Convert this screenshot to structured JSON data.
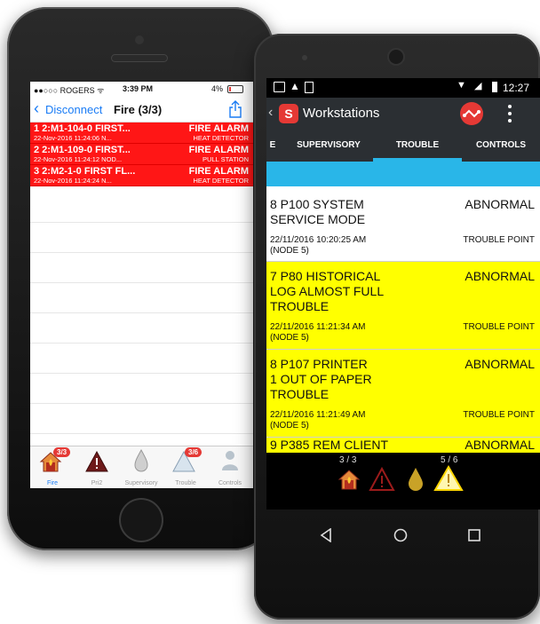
{
  "iphone": {
    "status": {
      "carrier": "●●○○○ ROGERS ᯤ",
      "time": "3:39 PM",
      "battery": "4%"
    },
    "nav": {
      "back_label": "Disconnect",
      "title": "Fire (3/3)"
    },
    "alarms": [
      {
        "title": "1 2:M1-104-0 FIRST...",
        "timestamp": "22-Nov-2016 11:24:06 N...",
        "type": "FIRE ALARM",
        "device": "HEAT DETECTOR"
      },
      {
        "title": "2 2:M1-109-0 FIRST...",
        "timestamp": "22-Nov-2016 11:24:12 NOD...",
        "type": "FIRE ALARM",
        "device": "PULL STATION"
      },
      {
        "title": "3 2:M2-1-0 FIRST FL...",
        "timestamp": "22-Nov-2016 11:24:24 N...",
        "type": "FIRE ALARM",
        "device": "HEAT DETECTOR"
      }
    ],
    "tabs": {
      "fire": {
        "label": "Fire",
        "badge": "3/3"
      },
      "pri2": {
        "label": "Pri2"
      },
      "supervisory": {
        "label": "Supervisory"
      },
      "trouble": {
        "label": "Trouble",
        "badge": "3/6"
      },
      "controls": {
        "label": "Controls"
      }
    },
    "colors": {
      "alarm_row": "#ff1616",
      "accent": "#1a7cf5"
    }
  },
  "android": {
    "status": {
      "time": "12:27"
    },
    "toolbar": {
      "title": "Workstations"
    },
    "tabs": {
      "left_fragment": "E",
      "supervisory": "SUPERVISORY",
      "trouble": "TROUBLE",
      "controls": "CONTROLS"
    },
    "events": [
      {
        "lines": [
          "8 P100 SYSTEM",
          "SERVICE MODE"
        ],
        "status": "ABNORMAL",
        "time": "22/11/2016 10:20:25 AM",
        "node": "(NODE 5)",
        "point": "TROUBLE POINT",
        "bg": "#ffffff"
      },
      {
        "lines": [
          "7 P80 HISTORICAL",
          "LOG ALMOST FULL",
          "TROUBLE"
        ],
        "status": "ABNORMAL",
        "time": "22/11/2016 11:21:34 AM",
        "node": "(NODE 5)",
        "point": "TROUBLE POINT",
        "bg": "#ffff00"
      },
      {
        "lines": [
          "8 P107 PRINTER",
          "1 OUT OF PAPER",
          "TROUBLE"
        ],
        "status": "ABNORMAL",
        "time": "22/11/2016 11:21:49 AM",
        "node": "(NODE 5)",
        "point": "TROUBLE POINT",
        "bg": "#ffff00"
      },
      {
        "lines": [
          "9 P385 REM CLIENT"
        ],
        "status": "ABNORMAL",
        "bg": "#ffff00"
      }
    ],
    "summary": {
      "fire_count": "3 / 3",
      "trouble_count": "5 / 6"
    },
    "colors": {
      "tab_indicator": "#29b6e8",
      "toolbar": "#2b2f33"
    }
  }
}
